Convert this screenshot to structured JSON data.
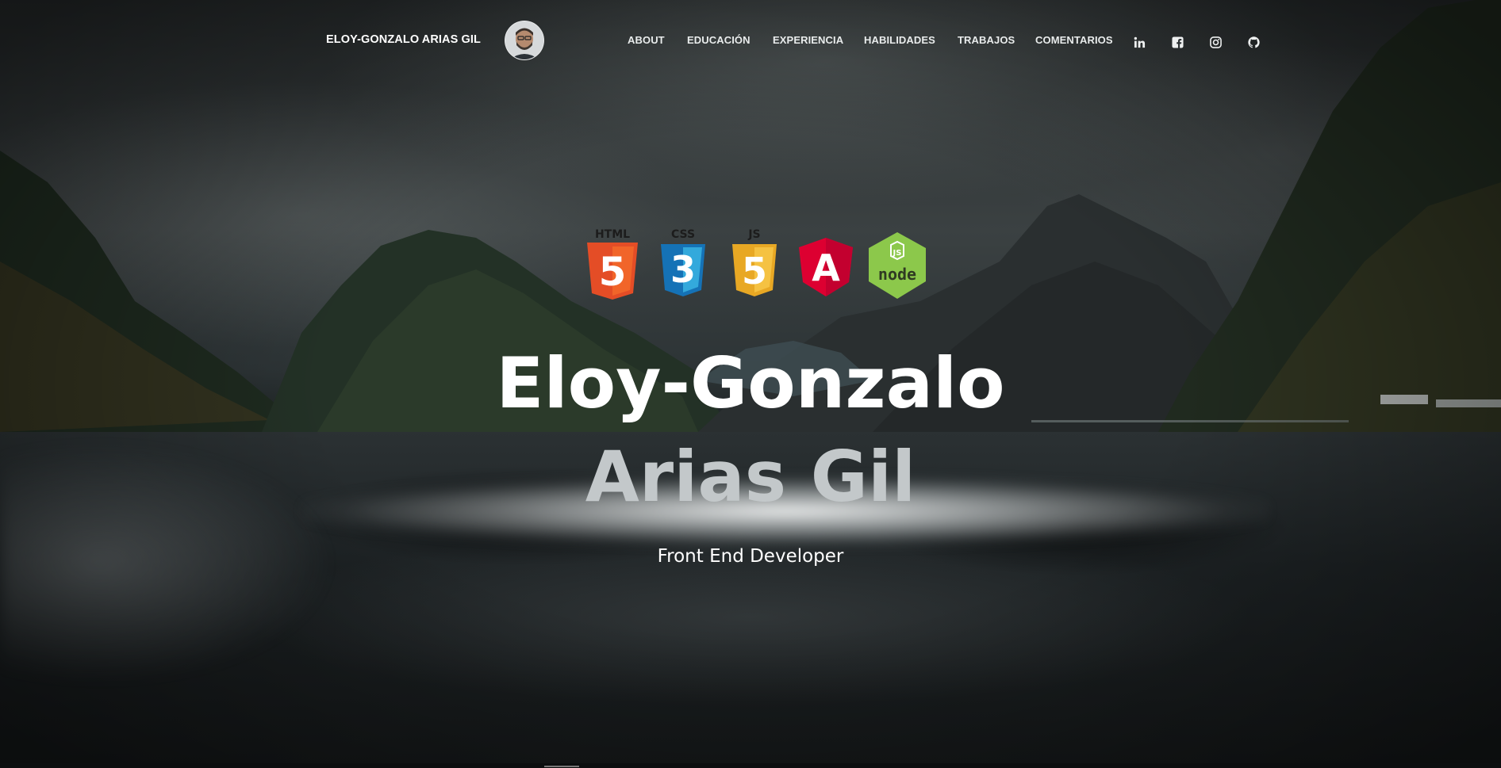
{
  "header": {
    "brand": "ELOY-GONZALO ARIAS GIL",
    "avatar_icon": "profile-photo",
    "menu": [
      {
        "label": "ABOUT"
      },
      {
        "label": "EDUCACIÓN"
      },
      {
        "label": "EXPERIENCIA"
      },
      {
        "label": "HABILIDADES"
      },
      {
        "label": "TRABAJOS"
      },
      {
        "label": "COMENTARIOS"
      }
    ],
    "social": [
      {
        "icon": "linkedin-icon"
      },
      {
        "icon": "facebook-icon"
      },
      {
        "icon": "instagram-icon"
      },
      {
        "icon": "github-icon"
      }
    ]
  },
  "hero": {
    "tech": [
      {
        "icon": "html5-icon",
        "caption": "HTML",
        "glyph": "5",
        "color": "#e44d26"
      },
      {
        "icon": "css3-icon",
        "caption": "CSS",
        "glyph": "3",
        "color": "#1572b6"
      },
      {
        "icon": "js-icon",
        "caption": "JS",
        "glyph": "5",
        "color": "#f0b030"
      },
      {
        "icon": "angular-icon",
        "caption": "",
        "glyph": "A",
        "color": "#dd0031"
      },
      {
        "icon": "nodejs-icon",
        "caption": "",
        "glyph": "node",
        "color": "#8cc84b"
      }
    ],
    "name_first": "Eloy-Gonzalo",
    "name_last": "Arias Gil",
    "role": "Front End Developer"
  }
}
